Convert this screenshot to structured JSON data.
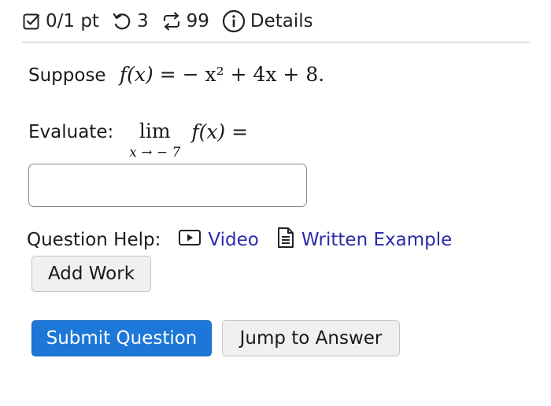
{
  "header": {
    "score": "0/1 pt",
    "retries": "3",
    "attempts": "99",
    "details_label": "Details"
  },
  "question": {
    "intro_label": "Suppose",
    "function_lhs": "f(x)",
    "function_rhs": "= − x² + 4x + 8.",
    "evaluate_label": "Evaluate:",
    "limit_word": "lim",
    "limit_subscript": "x → − 7",
    "limit_rhs": "f(x) ="
  },
  "answer": {
    "value": "",
    "placeholder": ""
  },
  "help": {
    "label": "Question Help:",
    "video_label": "Video",
    "written_label": "Written Example"
  },
  "buttons": {
    "add_work": "Add Work",
    "submit": "Submit Question",
    "jump": "Jump to Answer"
  },
  "colors": {
    "link": "#2a2aa8",
    "primary": "#1c77d8",
    "divider": "#c8c8c8"
  },
  "icons": [
    "checkbox-icon",
    "retry-icon",
    "attempts-icon",
    "info-icon",
    "video-icon",
    "document-icon"
  ]
}
